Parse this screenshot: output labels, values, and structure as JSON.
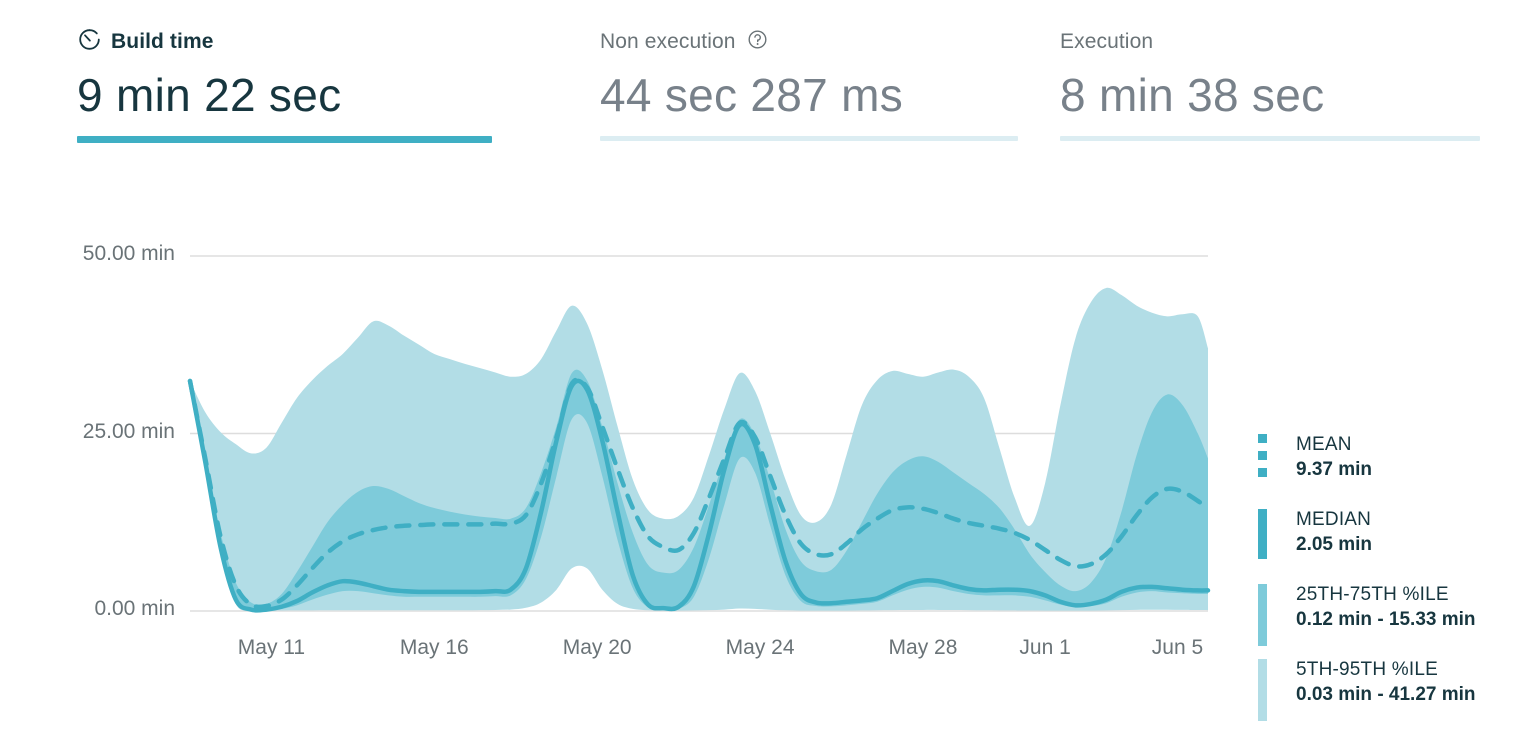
{
  "metrics": [
    {
      "id": "build-time",
      "label": "Build time",
      "value": "9 min 22 sec",
      "icon": "stopwatch-icon",
      "active": true,
      "underline_color": "#3fafc4"
    },
    {
      "id": "non-execution",
      "label": "Non execution",
      "value": "44 sec 287 ms",
      "icon": "help-circle-icon",
      "active": false,
      "underline_color": "#dcedf2"
    },
    {
      "id": "execution",
      "label": "Execution",
      "value": "8 min 38 sec",
      "icon": null,
      "active": false,
      "underline_color": "#dcedf2"
    }
  ],
  "legend": [
    {
      "title": "MEAN",
      "value": "9.37 min",
      "style": "dashed-line",
      "color": "#3fafc4"
    },
    {
      "title": "MEDIAN",
      "value": "2.05 min",
      "style": "solid-line",
      "color": "#3fafc4"
    },
    {
      "title": "25TH-75TH %ILE",
      "value": "0.12 min - 15.33 min",
      "style": "band",
      "color": "#7ecbda"
    },
    {
      "title": "5TH-95TH %ILE",
      "value": "0.03 min - 41.27 min",
      "style": "band",
      "color": "#b2dde6"
    }
  ],
  "chart_data": {
    "type": "area",
    "title": "Build time",
    "xlabel": "",
    "ylabel": "",
    "unit": "min",
    "ylim": [
      0,
      50
    ],
    "yticks": [
      0,
      25,
      50
    ],
    "ytick_labels": [
      "0.00 min",
      "25.00 min",
      "50.00 min"
    ],
    "grid": true,
    "legend_position": "right",
    "x_tick_labels": [
      "May 11",
      "May 16",
      "May 20",
      "May 24",
      "May 28",
      "Jun 1",
      "Jun 5"
    ],
    "x_tick_positions": [
      0.08,
      0.24,
      0.4,
      0.56,
      0.72,
      0.84,
      0.97
    ],
    "x": [
      0.0,
      0.015,
      0.03,
      0.045,
      0.06,
      0.075,
      0.09,
      0.105,
      0.12,
      0.135,
      0.15,
      0.165,
      0.18,
      0.195,
      0.21,
      0.225,
      0.24,
      0.255,
      0.27,
      0.285,
      0.3,
      0.315,
      0.33,
      0.345,
      0.36,
      0.375,
      0.39,
      0.405,
      0.42,
      0.435,
      0.45,
      0.465,
      0.48,
      0.495,
      0.51,
      0.525,
      0.54,
      0.555,
      0.57,
      0.585,
      0.6,
      0.615,
      0.63,
      0.645,
      0.66,
      0.675,
      0.69,
      0.705,
      0.72,
      0.735,
      0.75,
      0.765,
      0.78,
      0.795,
      0.81,
      0.825,
      0.84,
      0.855,
      0.87,
      0.885,
      0.9,
      0.915,
      0.93,
      0.945,
      0.96,
      0.975,
      0.99,
      1.0
    ],
    "series": [
      {
        "name": "MEDIAN",
        "style": "solid",
        "color": "#3fafc4",
        "values": [
          32.4,
          21.0,
          9.0,
          1.6,
          0.2,
          0.2,
          0.6,
          1.4,
          2.6,
          3.6,
          4.2,
          4.0,
          3.5,
          3.0,
          2.8,
          2.7,
          2.7,
          2.7,
          2.7,
          2.7,
          2.8,
          3.0,
          6.0,
          14.0,
          24.0,
          31.7,
          31.2,
          24.0,
          14.0,
          5.0,
          0.9,
          0.4,
          0.6,
          3.5,
          11.0,
          20.0,
          26.2,
          23.5,
          15.0,
          7.0,
          2.4,
          1.2,
          1.1,
          1.3,
          1.5,
          1.8,
          2.8,
          3.8,
          4.3,
          4.2,
          3.6,
          3.1,
          2.9,
          3.0,
          3.0,
          2.8,
          2.2,
          1.3,
          0.8,
          1.0,
          1.6,
          2.7,
          3.3,
          3.4,
          3.2,
          3.0,
          2.9,
          2.9
        ]
      },
      {
        "name": "MEAN",
        "style": "dashed",
        "color": "#3fafc4",
        "values": [
          32.4,
          21.5,
          10.5,
          3.6,
          0.9,
          0.7,
          1.6,
          3.6,
          6.0,
          8.2,
          9.8,
          10.8,
          11.4,
          11.8,
          12.0,
          12.1,
          12.2,
          12.2,
          12.2,
          12.2,
          12.3,
          12.3,
          13.5,
          18.0,
          24.5,
          32.0,
          31.5,
          26.0,
          20.0,
          14.5,
          10.5,
          9.0,
          8.6,
          11.0,
          16.0,
          21.5,
          26.5,
          24.5,
          19.0,
          13.5,
          9.5,
          8.0,
          8.0,
          9.5,
          11.5,
          13.0,
          14.2,
          14.6,
          14.4,
          13.8,
          13.0,
          12.4,
          12.0,
          11.6,
          11.0,
          10.0,
          8.6,
          7.2,
          6.3,
          6.6,
          8.0,
          10.5,
          13.5,
          16.0,
          17.2,
          16.8,
          15.5,
          14.5
        ]
      }
    ],
    "bands": [
      {
        "name": "5TH-95TH %ILE",
        "color": "#b2dde6",
        "lower": [
          32.4,
          21.0,
          8.5,
          1.0,
          0.1,
          0.06,
          0.07,
          0.08,
          0.09,
          0.1,
          0.1,
          0.1,
          0.1,
          0.1,
          0.1,
          0.1,
          0.1,
          0.1,
          0.1,
          0.12,
          0.15,
          0.2,
          0.45,
          1.2,
          3.0,
          6.0,
          6.0,
          3.0,
          1.0,
          0.3,
          0.1,
          0.06,
          0.06,
          0.08,
          0.12,
          0.2,
          0.35,
          0.3,
          0.18,
          0.1,
          0.06,
          0.05,
          0.05,
          0.06,
          0.08,
          0.1,
          0.12,
          0.14,
          0.15,
          0.15,
          0.14,
          0.12,
          0.1,
          0.09,
          0.08,
          0.07,
          0.06,
          0.05,
          0.05,
          0.06,
          0.08,
          0.12,
          0.16,
          0.18,
          0.18,
          0.16,
          0.14,
          0.13
        ],
        "upper": [
          32.4,
          28.0,
          25.2,
          23.5,
          22.2,
          23.0,
          26.5,
          30.0,
          32.5,
          34.5,
          36.2,
          38.5,
          40.8,
          40.2,
          38.8,
          37.5,
          36.2,
          35.5,
          34.8,
          34.2,
          33.6,
          33.0,
          33.4,
          35.5,
          39.5,
          43.0,
          40.5,
          34.0,
          26.0,
          18.5,
          14.2,
          13.0,
          13.4,
          16.0,
          22.0,
          28.5,
          33.5,
          31.0,
          25.0,
          18.5,
          13.5,
          12.5,
          15.0,
          22.0,
          29.0,
          32.5,
          33.8,
          33.4,
          33.0,
          33.6,
          34.0,
          33.0,
          30.0,
          23.0,
          16.0,
          12.0,
          18.0,
          29.0,
          38.5,
          43.5,
          45.5,
          44.5,
          43.0,
          42.0,
          41.5,
          41.8,
          41.5,
          37.0
        ]
      },
      {
        "name": "25TH-75TH %ILE",
        "color": "#7ecbda",
        "lower": [
          32.4,
          21.0,
          8.8,
          1.3,
          0.15,
          0.12,
          0.3,
          0.8,
          1.6,
          2.3,
          2.8,
          2.8,
          2.5,
          2.2,
          2.0,
          2.0,
          2.0,
          2.0,
          2.0,
          2.0,
          2.1,
          2.2,
          4.5,
          10.5,
          19.0,
          27.0,
          26.5,
          19.0,
          10.0,
          3.2,
          0.5,
          0.2,
          0.3,
          2.0,
          7.5,
          15.0,
          21.5,
          19.5,
          12.0,
          5.0,
          1.4,
          0.7,
          0.65,
          0.8,
          1.0,
          1.3,
          2.2,
          3.0,
          3.4,
          3.3,
          2.8,
          2.4,
          2.2,
          2.2,
          2.2,
          2.0,
          1.5,
          0.9,
          0.55,
          0.7,
          1.1,
          2.0,
          2.6,
          2.8,
          2.6,
          2.5,
          2.4,
          2.4
        ]
      },
      {
        "name": "25TH-75TH %ILE UPPER",
        "color": "#7ecbda",
        "upper": [
          32.4,
          21.5,
          11.0,
          4.0,
          1.2,
          1.0,
          2.4,
          5.5,
          9.0,
          12.5,
          15.0,
          16.8,
          17.6,
          17.2,
          16.2,
          15.2,
          14.5,
          14.0,
          13.6,
          13.3,
          13.1,
          13.0,
          14.5,
          19.5,
          26.0,
          33.5,
          32.5,
          26.0,
          18.0,
          11.0,
          6.5,
          5.4,
          5.8,
          9.0,
          15.0,
          21.5,
          27.0,
          24.8,
          18.5,
          11.5,
          7.0,
          5.6,
          5.8,
          8.5,
          12.5,
          16.5,
          19.5,
          21.2,
          21.8,
          21.0,
          19.5,
          18.0,
          16.5,
          14.5,
          11.5,
          8.0,
          5.5,
          3.6,
          2.8,
          4.0,
          7.5,
          14.0,
          22.0,
          28.0,
          30.5,
          29.0,
          25.0,
          21.5
        ]
      }
    ]
  }
}
